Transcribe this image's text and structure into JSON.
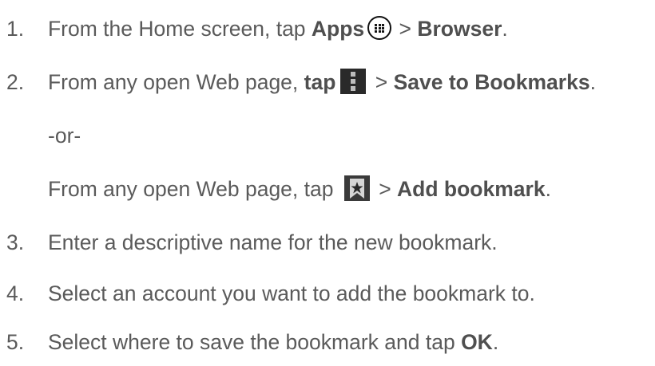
{
  "steps": [
    {
      "number": "1.",
      "pre": "From the Home screen, tap ",
      "bold1": "Apps",
      "sep": " > ",
      "bold2": "Browser",
      "post": ".",
      "icon": "apps-grid-icon"
    },
    {
      "number": "2.",
      "pre": "From any open Web page, ",
      "bold1": "tap",
      "sep": " > ",
      "bold2": "Save to Bookmarks",
      "post": ".",
      "icon": "menu-overflow-icon"
    },
    {
      "or_text": "-or-"
    },
    {
      "pre": "From any open Web page, tap ",
      "sep": " > ",
      "bold2": "Add bookmark",
      "post": ".",
      "icon": "bookmark-star-icon"
    },
    {
      "number": "3.",
      "text": "Enter a descriptive name for the new bookmark."
    },
    {
      "number": "4.",
      "text": "Select an account you want to add the bookmark to."
    },
    {
      "number": "5.",
      "pre": "Select where to save the bookmark and tap ",
      "bold": "OK",
      "post": "."
    }
  ]
}
